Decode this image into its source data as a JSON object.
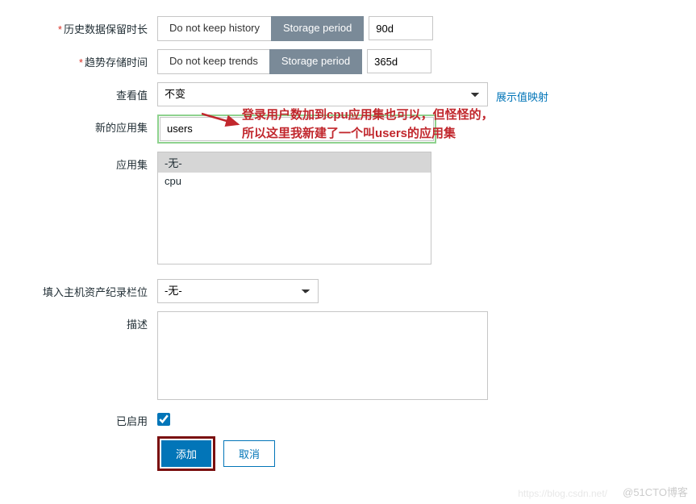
{
  "history": {
    "label": "历史数据保留时长",
    "opt_no_keep": "Do not keep history",
    "opt_period": "Storage period",
    "value": "90d"
  },
  "trends": {
    "label": "趋势存储时间",
    "opt_no_keep": "Do not keep trends",
    "opt_period": "Storage period",
    "value": "365d"
  },
  "show_value": {
    "label": "查看值",
    "selected": "不变",
    "link": "展示值映射"
  },
  "new_app": {
    "label": "新的应用集",
    "value": "users"
  },
  "app_set": {
    "label": "应用集",
    "items": {
      "none": "-无-",
      "cpu": "cpu"
    }
  },
  "host_inv": {
    "label": "填入主机资产纪录栏位",
    "selected": "-无-"
  },
  "description": {
    "label": "描述",
    "value": ""
  },
  "enabled": {
    "label": "已启用",
    "checked": true
  },
  "buttons": {
    "add": "添加",
    "cancel": "取消"
  },
  "annotation": {
    "line1": "登录用户数加到cpu应用集也可以，但怪怪的，",
    "line2": "所以这里我新建了一个叫users的应用集"
  },
  "watermark": "@51CTO博客",
  "watermark2": "https://blog.csdn.net/"
}
